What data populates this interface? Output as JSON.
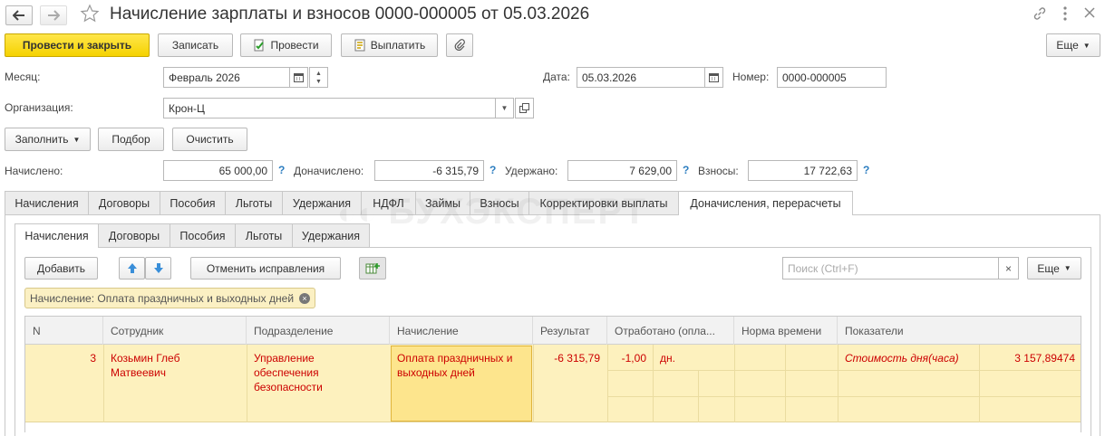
{
  "window": {
    "title": "Начисление зарплаты и взносов 0000-000005 от 05.03.2026"
  },
  "toolbar": {
    "post_close": "Провести и закрыть",
    "save": "Записать",
    "post": "Провести",
    "pay": "Выплатить",
    "more": "Еще"
  },
  "header": {
    "month_label": "Месяц:",
    "month_value": "Февраль 2026",
    "date_label": "Дата:",
    "date_value": "05.03.2026",
    "number_label": "Номер:",
    "number_value": "0000-000005",
    "org_label": "Организация:",
    "org_value": "Крон-Ц"
  },
  "actions": {
    "fill": "Заполнить",
    "pick": "Подбор",
    "clear": "Очистить"
  },
  "totals": {
    "accrued_label": "Начислено:",
    "accrued_value": "65 000,00",
    "extra_label": "Доначислено:",
    "extra_value": "-6 315,79",
    "withheld_label": "Удержано:",
    "withheld_value": "7 629,00",
    "contrib_label": "Взносы:",
    "contrib_value": "17 722,63",
    "help": "?"
  },
  "tabs": [
    "Начисления",
    "Договоры",
    "Пособия",
    "Льготы",
    "Удержания",
    "НДФЛ",
    "Займы",
    "Взносы",
    "Корректировки выплаты",
    "Доначисления, перерасчеты"
  ],
  "subtabs": [
    "Начисления",
    "Договоры",
    "Пособия",
    "Льготы",
    "Удержания"
  ],
  "subtoolbar": {
    "add": "Добавить",
    "cancel_corrections": "Отменить исправления",
    "search_placeholder": "Поиск (Ctrl+F)",
    "more": "Еще"
  },
  "filter": {
    "text": "Начисление: Оплата праздничных и выходных дней"
  },
  "table": {
    "headers": [
      "N",
      "Сотрудник",
      "Подразделение",
      "Начисление",
      "Результат",
      "Отработано (опла...",
      "Норма времени",
      "Показатели"
    ],
    "row": {
      "n": "3",
      "employee": "Козьмин Глеб Матвеевич",
      "department": "Управление обеспечения безопасности",
      "accrual": "Оплата праздничных и выходных дней",
      "result": "-6 315,79",
      "worked": "-1,00",
      "worked_unit": "дн.",
      "indicator_name": "Стоимость дня(часа)",
      "indicator_value": "3 157,89474"
    }
  },
  "watermark": "БУХЭКСПЕРТ",
  "colors": {
    "primary": "#f5d200",
    "row_highlight": "#fdf1be",
    "selected_cell": "#fde58d",
    "error_text": "#cc0000",
    "help": "#2d7ec0"
  }
}
